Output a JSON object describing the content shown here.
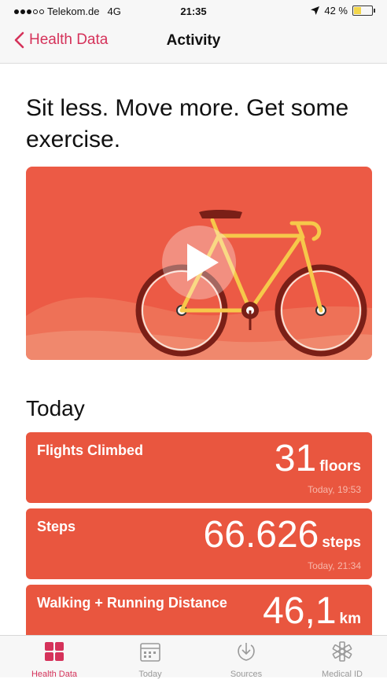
{
  "status": {
    "carrier": "Telekom.de",
    "network": "4G",
    "time": "21:35",
    "battery": "42 %",
    "battery_level": 0.42
  },
  "nav": {
    "back_label": "Health Data",
    "title": "Activity"
  },
  "headline": "Sit less. Move more. Get some exercise.",
  "section_title": "Today",
  "cards": [
    {
      "label": "Flights Climbed",
      "value": "31",
      "unit": "floors",
      "time": "Today, 19:53"
    },
    {
      "label": "Steps",
      "value": "66.626",
      "unit": "steps",
      "time": "Today, 21:34"
    },
    {
      "label": "Walking + Running Distance",
      "value": "46,1",
      "unit": "km",
      "time": ""
    }
  ],
  "tabs": [
    {
      "label": "Health Data",
      "icon": "grid-icon",
      "active": true
    },
    {
      "label": "Today",
      "icon": "calendar-icon",
      "active": false
    },
    {
      "label": "Sources",
      "icon": "download-icon",
      "active": false
    },
    {
      "label": "Medical ID",
      "icon": "medical-star-icon",
      "active": false
    }
  ],
  "colors": {
    "accent": "#d5325a",
    "card": "#e9563f",
    "video_bg": "#ec5a45"
  }
}
